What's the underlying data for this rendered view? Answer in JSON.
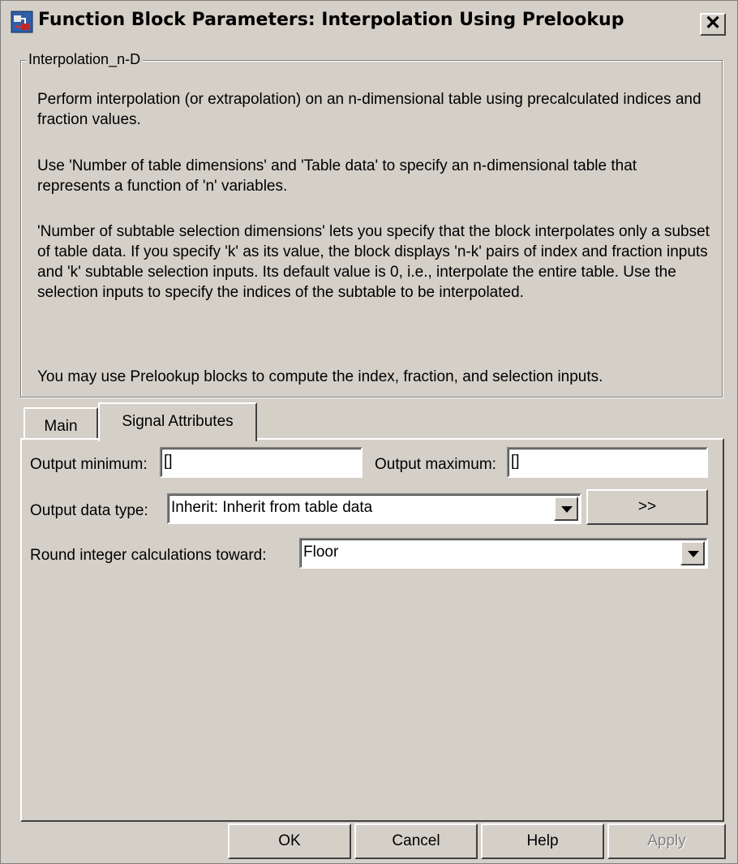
{
  "window": {
    "title": "Function Block Parameters: Interpolation Using Prelookup"
  },
  "group": {
    "label": "Interpolation_n-D",
    "paragraphs": [
      "Perform interpolation (or extrapolation) on an n-dimensional table using precalculated indices and fraction values.",
      "Use 'Number of table dimensions' and 'Table data' to specify an n-dimensional table that represents a function of 'n' variables.",
      "'Number of subtable selection dimensions' lets you specify that the block interpolates only a subset of table data. If you specify 'k' as its value, the block displays 'n-k' pairs of index and fraction inputs and 'k' subtable selection inputs. Its default value is 0, i.e., interpolate the entire table. Use the selection inputs to specify the indices of the subtable to be interpolated.",
      "You may use Prelookup blocks to compute the index, fraction, and selection inputs."
    ]
  },
  "tabs": [
    {
      "label": "Main",
      "selected": false
    },
    {
      "label": "Signal Attributes",
      "selected": true
    }
  ],
  "signal_attributes": {
    "output_minimum": {
      "label": "Output minimum:",
      "value": "[]"
    },
    "output_maximum": {
      "label": "Output maximum:",
      "value": "[]"
    },
    "output_data_type": {
      "label": "Output data type:",
      "value": "Inherit: Inherit from table data",
      "assistant_label": ">>"
    },
    "round_toward": {
      "label": "Round integer calculations toward:",
      "value": "Floor"
    }
  },
  "buttons": {
    "ok": "OK",
    "cancel": "Cancel",
    "help": "Help",
    "apply": "Apply"
  },
  "colors": {
    "dialog_bg": "#d4d0c8",
    "disabled_text": "#808080"
  },
  "icons": {
    "app": "simulink-block-icon",
    "close": "close-icon",
    "dropdown": "chevron-down-icon"
  }
}
